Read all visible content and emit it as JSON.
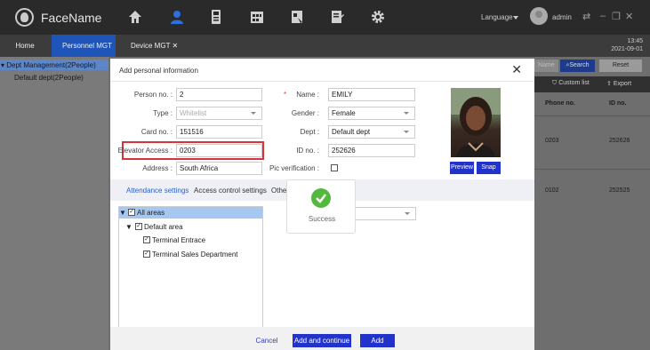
{
  "app": {
    "name": "FaceName",
    "language_label": "Language",
    "user": "admin"
  },
  "tabs": [
    {
      "label": "Home"
    },
    {
      "label": "Personnel MGT"
    },
    {
      "label": "Device MGT"
    }
  ],
  "clock": {
    "time": "13:45",
    "date": "2021-09-01"
  },
  "left_tree": {
    "root": "Dept Management(2People)",
    "child": "Default dept(2People)"
  },
  "background_table": {
    "search_placeholder": "Name",
    "search_button": "Search",
    "reset_button": "Reset",
    "custom_list": "Custom list",
    "export": "Export",
    "columns": [
      "Phone no.",
      "ID no."
    ],
    "rows": [
      {
        "phone": "0203",
        "id": "252626"
      },
      {
        "phone": "0102",
        "id": "252525"
      }
    ]
  },
  "dialog": {
    "title": "Add personal information",
    "close": "✕",
    "fields": {
      "person_no_label": "Person no. :",
      "person_no_value": "2",
      "type_label": "Type :",
      "type_value": "Whitelist",
      "card_no_label": "Card no. :",
      "card_no_value": "151516",
      "elevator_label": "Elevator Access :",
      "elevator_value": "0203",
      "address_label": "Address :",
      "address_value": "South Africa",
      "name_label": "Name :",
      "name_value": "EMILY",
      "gender_label": "Gender :",
      "gender_value": "Female",
      "dept_label": "Dept :",
      "dept_value": "Default dept",
      "id_no_label": "ID no. :",
      "id_no_value": "252626",
      "pic_verification_label": "Pic verification :"
    },
    "preview_button": "Preview",
    "snap_button": "Snap",
    "tabs": [
      "Attendance settings",
      "Access control settings",
      "Other"
    ],
    "tree": {
      "root": "All areas",
      "area": "Default area",
      "items": [
        "Terminal Entrace",
        "Terminal Sales Department"
      ]
    },
    "success_text": "Success",
    "cancel_button": "Cancel",
    "add_continue_button": "Add and continue",
    "add_button": "Add"
  },
  "colors": {
    "topbar": "#2a2a2a",
    "accent_blue": "#2233cc",
    "highlight_red": "#d9323a",
    "success_green": "#52b83e"
  }
}
